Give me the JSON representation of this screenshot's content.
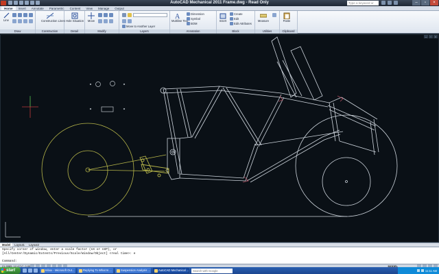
{
  "window": {
    "title": "AutoCAD Mechanical 2011    Frame.dwg - Read Only",
    "search_placeholder": "Type a keyword or phrase"
  },
  "ribbon_tabs": [
    "Home",
    "Insert",
    "Annotate",
    "Parametric",
    "Content",
    "View",
    "Manage",
    "Output"
  ],
  "ribbon": {
    "draw": {
      "title": "Draw",
      "line": "Line"
    },
    "construction": {
      "title": "Construction",
      "lines": "Construction Lines"
    },
    "detail": {
      "title": "Detail",
      "hole": "Hole Situation"
    },
    "modify": {
      "title": "Modify",
      "move": "Move"
    },
    "layers": {
      "title": "Layers",
      "move_layer": "Move to Another Layer"
    },
    "annotation": {
      "title": "Annotation",
      "multiline": "Multiline Text",
      "dimension": "Dimension",
      "symbol": "Symbol",
      "bom": "BOM"
    },
    "block": {
      "title": "Block",
      "insert": "Insert",
      "create": "Create",
      "edit": "Edit",
      "edit_attributes": "Edit Attributes"
    },
    "utilities": {
      "title": "Utilities",
      "measure": "Measure"
    },
    "clipboard": {
      "title": "Clipboard",
      "paste": "Paste"
    }
  },
  "layout_tabs": [
    "Model",
    "Layout1",
    "Layout2"
  ],
  "command": {
    "line1": "Specify corner of window, enter a scale factor (nX or nXP), or",
    "line2": "[All/Center/Dynamic/Extents/Previous/Scale/Window/Object] <real time>: e",
    "prompt": "Command:"
  },
  "status": {
    "coords": "21.9985, 12.4717, 0.0000",
    "model": "MODEL"
  },
  "taskbar": {
    "start": "start",
    "tasks": [
      "Inbox - Microsoft Out...",
      "Replying To What Is ...",
      "Suspension Analysis ...",
      "AutoCAD Mechanical ..."
    ],
    "search_placeholder": "Search with Google",
    "time": "11:11 AM"
  },
  "colors": {
    "drawing_bg": "#0a1016",
    "frame_lines": "#cfd6de",
    "wheel_yellow": "#b9b84a",
    "accent_red": "#a8485a",
    "crosshair": "#c0393b"
  }
}
